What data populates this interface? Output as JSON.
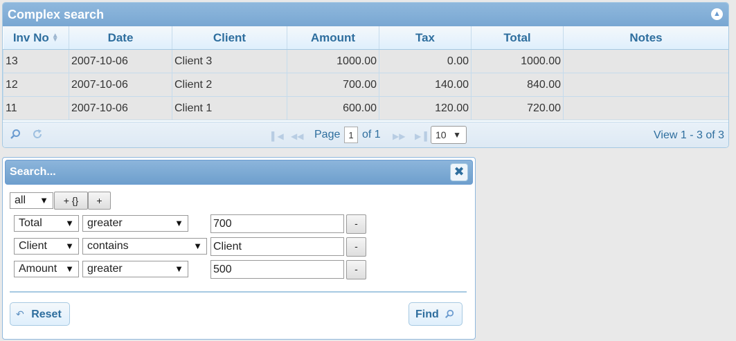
{
  "grid": {
    "caption": "Complex search",
    "columns": [
      "Inv No",
      "Date",
      "Client",
      "Amount",
      "Tax",
      "Total",
      "Notes"
    ],
    "rows": [
      {
        "inv": "13",
        "date": "2007-10-06",
        "client": "Client 3",
        "amount": "1000.00",
        "tax": "0.00",
        "total": "1000.00",
        "notes": ""
      },
      {
        "inv": "12",
        "date": "2007-10-06",
        "client": "Client 2",
        "amount": "700.00",
        "tax": "140.00",
        "total": "840.00",
        "notes": ""
      },
      {
        "inv": "11",
        "date": "2007-10-06",
        "client": "Client 1",
        "amount": "600.00",
        "tax": "120.00",
        "total": "720.00",
        "notes": ""
      }
    ],
    "pager": {
      "page_label": "Page",
      "page_value": "1",
      "of_label": "of 1",
      "rows_per_page": "10",
      "view_info": "View 1 - 3 of 3"
    }
  },
  "search": {
    "title": "Search...",
    "group_op": "all",
    "add_group_label": "+ {}",
    "add_rule_label": "+",
    "rules": [
      {
        "field": "Total",
        "op": "greater",
        "value": "700",
        "remove": "-"
      },
      {
        "field": "Client",
        "op": "contains",
        "value": "Client",
        "remove": "-"
      },
      {
        "field": "Amount",
        "op": "greater",
        "value": "500",
        "remove": "-"
      }
    ],
    "reset_label": "Reset",
    "find_label": "Find"
  },
  "colors": {
    "header_blue": "#79a7d2",
    "text_blue": "#2e6e9e",
    "border_blue": "#a6c9e2"
  }
}
